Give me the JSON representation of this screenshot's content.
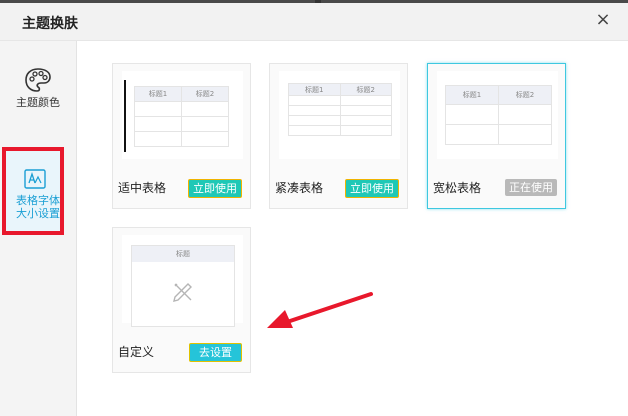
{
  "dialog": {
    "title": "主题换肤",
    "close_glyph": "×"
  },
  "sidebar": {
    "items": [
      {
        "label": "主题颜色",
        "icon": "palette-icon"
      },
      {
        "label_line1": "表格字体",
        "label_line2": "大小设置",
        "icon": "font-size-icon",
        "active": true
      }
    ]
  },
  "cards": [
    {
      "name": "适中表格",
      "button": "立即使用",
      "headers": [
        "标题1",
        "标题2"
      ]
    },
    {
      "name": "紧凑表格",
      "button": "立即使用",
      "headers": [
        "标题1",
        "标题2"
      ]
    },
    {
      "name": "宽松表格",
      "button": "正在使用",
      "headers": [
        "标题1",
        "标题2"
      ],
      "selected": true
    },
    {
      "name": "自定义",
      "button": "去设置",
      "headers": [
        "标题"
      ]
    }
  ],
  "colors": {
    "accent": "#1a9fd4",
    "highlight_border": "#e8182c",
    "use_button": "#1fc8b6",
    "inuse_button": "#b9b9b9",
    "selected_border": "#3ec8e0",
    "annotation_arrow": "#e8182c"
  }
}
